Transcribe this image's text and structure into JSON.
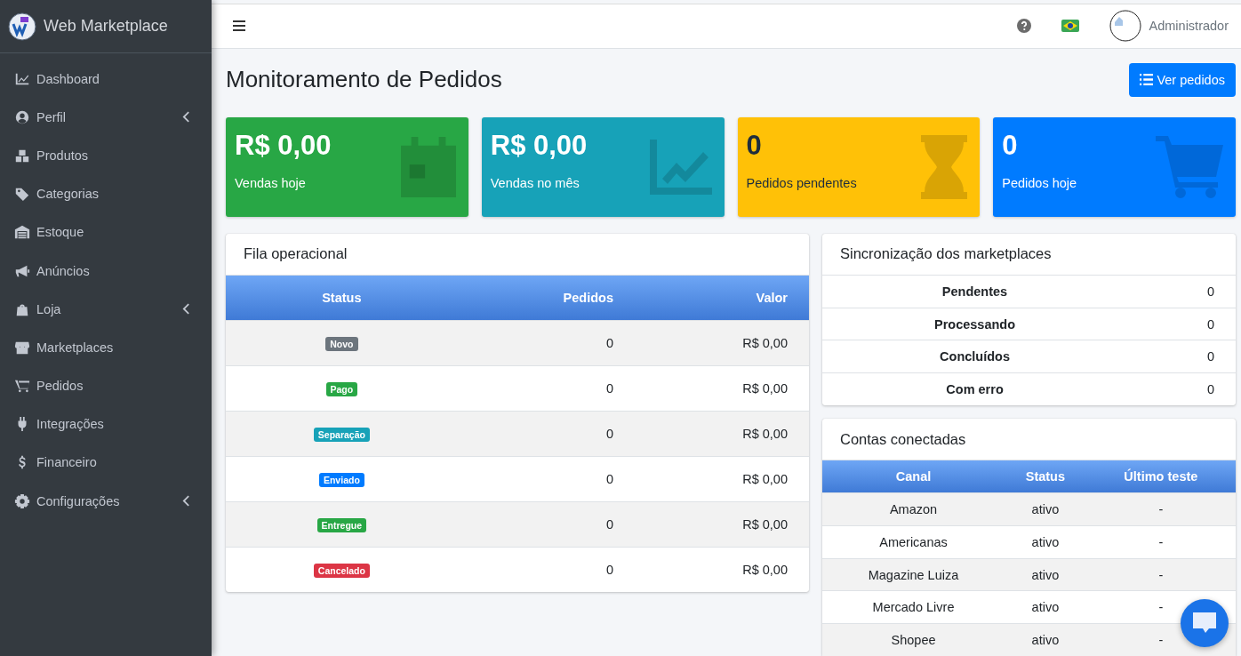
{
  "brand": {
    "title": "Web Marketplace"
  },
  "sidebar": {
    "items": [
      {
        "label": "Dashboard",
        "expandable": false
      },
      {
        "label": "Perfil",
        "expandable": true
      },
      {
        "label": "Produtos",
        "expandable": false
      },
      {
        "label": "Categorias",
        "expandable": false
      },
      {
        "label": "Estoque",
        "expandable": false
      },
      {
        "label": "Anúncios",
        "expandable": false
      },
      {
        "label": "Loja",
        "expandable": true
      },
      {
        "label": "Marketplaces",
        "expandable": false
      },
      {
        "label": "Pedidos",
        "expandable": false
      },
      {
        "label": "Integrações",
        "expandable": false
      },
      {
        "label": "Financeiro",
        "expandable": false
      },
      {
        "label": "Configurações",
        "expandable": true
      }
    ]
  },
  "topbar": {
    "user": "Administrador"
  },
  "page": {
    "title": "Monitoramento de Pedidos",
    "action": "Ver pedidos"
  },
  "stats": [
    {
      "value": "R$ 0,00",
      "label": "Vendas hoje",
      "color": "#28a745"
    },
    {
      "value": "R$ 0,00",
      "label": "Vendas no mês",
      "color": "#17a2b8"
    },
    {
      "value": "0",
      "label": "Pedidos pendentes",
      "color": "#ffc107"
    },
    {
      "value": "0",
      "label": "Pedidos hoje",
      "color": "#007bff"
    }
  ],
  "queue": {
    "title": "Fila operacional",
    "columns": [
      "Status",
      "Pedidos",
      "Valor"
    ],
    "rows": [
      {
        "status": "Novo",
        "color": "#6c757d",
        "orders": "0",
        "value": "R$ 0,00"
      },
      {
        "status": "Pago",
        "color": "#28a745",
        "orders": "0",
        "value": "R$ 0,00"
      },
      {
        "status": "Separação",
        "color": "#17a2b8",
        "orders": "0",
        "value": "R$ 0,00"
      },
      {
        "status": "Enviado",
        "color": "#007bff",
        "orders": "0",
        "value": "R$ 0,00"
      },
      {
        "status": "Entregue",
        "color": "#28a745",
        "orders": "0",
        "value": "R$ 0,00"
      },
      {
        "status": "Cancelado",
        "color": "#dc3545",
        "orders": "0",
        "value": "R$ 0,00"
      }
    ]
  },
  "sync": {
    "title": "Sincronização dos marketplaces",
    "rows": [
      {
        "label": "Pendentes",
        "count": "0"
      },
      {
        "label": "Processando",
        "count": "0"
      },
      {
        "label": "Concluídos",
        "count": "0"
      },
      {
        "label": "Com erro",
        "count": "0"
      }
    ]
  },
  "accounts": {
    "title": "Contas conectadas",
    "columns": [
      "Canal",
      "Status",
      "Último teste"
    ],
    "rows": [
      {
        "channel": "Amazon",
        "status": "ativo",
        "last_test": "-"
      },
      {
        "channel": "Americanas",
        "status": "ativo",
        "last_test": "-"
      },
      {
        "channel": "Magazine Luiza",
        "status": "ativo",
        "last_test": "-"
      },
      {
        "channel": "Mercado Livre",
        "status": "ativo",
        "last_test": "-"
      },
      {
        "channel": "Shopee",
        "status": "ativo",
        "last_test": "-"
      }
    ]
  }
}
